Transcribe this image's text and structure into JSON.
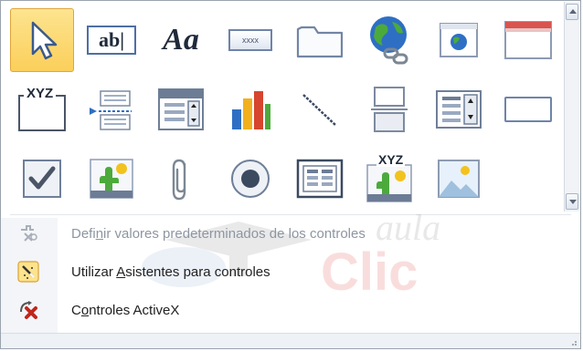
{
  "controls_gallery": {
    "rows": [
      [
        {
          "name": "select-pointer-icon",
          "selected": true
        },
        {
          "name": "text-box-icon",
          "text": "ab|"
        },
        {
          "name": "label-icon",
          "text": "Aa"
        },
        {
          "name": "button-icon",
          "text": "xxxx"
        },
        {
          "name": "tab-control-icon"
        },
        {
          "name": "hyperlink-icon"
        },
        {
          "name": "web-browser-control-icon"
        },
        {
          "name": "navigation-control-icon"
        }
      ],
      [
        {
          "name": "option-group-icon",
          "text": "XYZ"
        },
        {
          "name": "insert-page-break-icon"
        },
        {
          "name": "combo-box-icon"
        },
        {
          "name": "chart-icon"
        },
        {
          "name": "line-icon"
        },
        {
          "name": "toggle-button-icon"
        },
        {
          "name": "list-box-icon"
        },
        {
          "name": "rectangle-icon"
        }
      ],
      [
        {
          "name": "check-box-icon"
        },
        {
          "name": "unbound-object-frame-icon"
        },
        {
          "name": "attachment-icon"
        },
        {
          "name": "option-button-icon"
        },
        {
          "name": "subform-icon"
        },
        {
          "name": "bound-object-frame-icon",
          "text": "XYZ"
        },
        {
          "name": "image-icon"
        }
      ]
    ]
  },
  "menu": {
    "items": [
      {
        "pre": "Defi",
        "accel": "n",
        "post": "ir valores predeterminados de los controles",
        "disabled": true,
        "icon": "set-control-defaults-icon"
      },
      {
        "pre": "Utilizar ",
        "accel": "A",
        "post": "sistentes para controles",
        "disabled": false,
        "icon": "use-control-wizards-icon"
      },
      {
        "pre": "C",
        "accel": "o",
        "post": "ntroles ActiveX",
        "disabled": false,
        "icon": "activex-controls-icon"
      }
    ]
  },
  "watermark": {
    "line1": "aula",
    "line2": "Clic"
  },
  "colors": {
    "selected_bg": "#fcd86f",
    "disabled_text": "#8d96a1",
    "accent_blue": "#2e6fc4"
  }
}
